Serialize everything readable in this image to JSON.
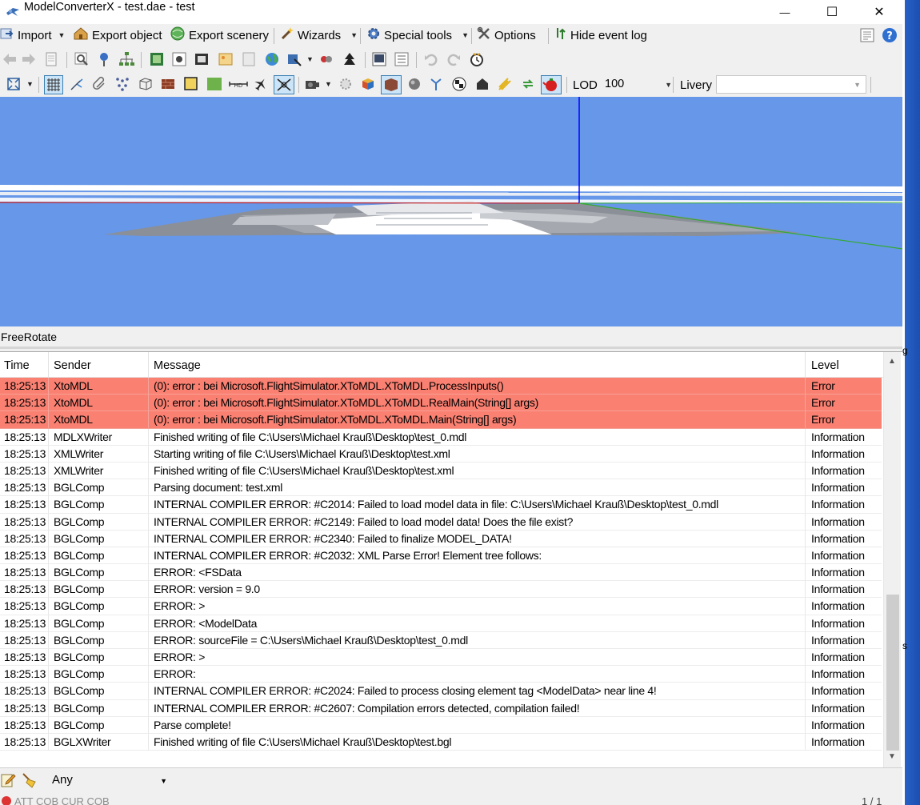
{
  "window": {
    "title": "ModelConverterX - test.dae - test",
    "minimize_glyph": "—",
    "maximize_glyph": "☐",
    "close_glyph": "✕"
  },
  "toolbar1": {
    "import": "Import",
    "export_object": "Export object",
    "export_scenery": "Export scenery",
    "wizards": "Wizards",
    "special_tools": "Special tools",
    "options": "Options",
    "hide_event_log": "Hide event log"
  },
  "toolbar3": {
    "lod_label": "LOD",
    "lod_value": "100",
    "livery_label": "Livery",
    "livery_value": ""
  },
  "viewport": {
    "mode": "FreeRotate"
  },
  "log": {
    "columns": [
      "Time",
      "Sender",
      "Message",
      "Level"
    ],
    "rows": [
      {
        "time": "18:25:13",
        "sender": "XtoMDL",
        "message": "(0): error :    bei Microsoft.FlightSimulator.XToMDL.XToMDL.ProcessInputs()",
        "level": "Error"
      },
      {
        "time": "18:25:13",
        "sender": "XtoMDL",
        "message": "(0): error :    bei Microsoft.FlightSimulator.XToMDL.XToMDL.RealMain(String[] args)",
        "level": "Error"
      },
      {
        "time": "18:25:13",
        "sender": "XtoMDL",
        "message": "(0): error :    bei Microsoft.FlightSimulator.XToMDL.XToMDL.Main(String[] args)",
        "level": "Error"
      },
      {
        "time": "18:25:13",
        "sender": "MDLXWriter",
        "message": "Finished writing of file C:\\Users\\Michael Krauß\\Desktop\\test_0.mdl",
        "level": "Information"
      },
      {
        "time": "18:25:13",
        "sender": "XMLWriter",
        "message": "Starting writing of file C:\\Users\\Michael Krauß\\Desktop\\test.xml",
        "level": "Information"
      },
      {
        "time": "18:25:13",
        "sender": "XMLWriter",
        "message": "Finished writing of file C:\\Users\\Michael Krauß\\Desktop\\test.xml",
        "level": "Information"
      },
      {
        "time": "18:25:13",
        "sender": "BGLComp",
        "message": "Parsing document: test.xml",
        "level": "Information"
      },
      {
        "time": "18:25:13",
        "sender": "BGLComp",
        "message": "INTERNAL COMPILER ERROR:  #C2014: Failed to load model data in file: C:\\Users\\Michael Krauß\\Desktop\\test_0.mdl",
        "level": "Information"
      },
      {
        "time": "18:25:13",
        "sender": "BGLComp",
        "message": "INTERNAL COMPILER ERROR:  #C2149: Failed to load model data!  Does the file exist?",
        "level": "Information"
      },
      {
        "time": "18:25:13",
        "sender": "BGLComp",
        "message": "INTERNAL COMPILER ERROR:  #C2340: Failed to finalize MODEL_DATA!",
        "level": "Information"
      },
      {
        "time": "18:25:13",
        "sender": "BGLComp",
        "message": "INTERNAL COMPILER ERROR:  #C2032: XML Parse Error!  Element tree follows:",
        "level": "Information"
      },
      {
        "time": "18:25:13",
        "sender": "BGLComp",
        "message": "ERROR: <FSData",
        "level": "Information"
      },
      {
        "time": "18:25:13",
        "sender": "BGLComp",
        "message": "ERROR: version = 9.0",
        "level": "Information"
      },
      {
        "time": "18:25:13",
        "sender": "BGLComp",
        "message": "ERROR: >",
        "level": "Information"
      },
      {
        "time": "18:25:13",
        "sender": "BGLComp",
        "message": "ERROR: <ModelData",
        "level": "Information"
      },
      {
        "time": "18:25:13",
        "sender": "BGLComp",
        "message": "ERROR: sourceFile = C:\\Users\\Michael Krauß\\Desktop\\test_0.mdl",
        "level": "Information"
      },
      {
        "time": "18:25:13",
        "sender": "BGLComp",
        "message": "ERROR: >",
        "level": "Information"
      },
      {
        "time": "18:25:13",
        "sender": "BGLComp",
        "message": "ERROR:",
        "level": "Information"
      },
      {
        "time": "18:25:13",
        "sender": "BGLComp",
        "message": "INTERNAL COMPILER ERROR:  #C2024: Failed to process closing element tag <ModelData> near line 4!",
        "level": "Information"
      },
      {
        "time": "18:25:13",
        "sender": "BGLComp",
        "message": "INTERNAL COMPILER ERROR:  #C2607: Compilation errors detected, compilation failed!",
        "level": "Information"
      },
      {
        "time": "18:25:13",
        "sender": "BGLComp",
        "message": "Parse complete!",
        "level": "Information"
      },
      {
        "time": "18:25:13",
        "sender": "BGLXWriter",
        "message": "Finished writing of file C:\\Users\\Michael Krauß\\Desktop\\test.bgl",
        "level": "Information"
      }
    ]
  },
  "filter": {
    "level_value": "Any"
  },
  "status": {
    "text": "ATT COB  CUR COB",
    "pager": "1 / 1"
  },
  "desktop_glyphs": {
    "side_top": "g",
    "side_bottom": "s"
  },
  "colors": {
    "error_row": "#fa8072",
    "viewport_sky": "#6697e8",
    "axis_z": "#0000ff",
    "axis_x": "#cc2222",
    "axis_y": "#33aa33"
  },
  "icons": [
    "app-logo-icon",
    "import-icon",
    "export-object-icon",
    "export-scenery-icon",
    "wizard-wand-icon",
    "gear-icon",
    "tools-icon",
    "event-log-icon",
    "document-icon",
    "help-icon",
    "back-arrow-icon",
    "forward-arrow-icon",
    "zoom-icon",
    "pin-icon",
    "hierarchy-icon",
    "grid-icon",
    "undo-icon",
    "redo-icon",
    "clock-icon",
    "fit-view-icon",
    "teapot-icon",
    "notepad-icon",
    "broom-icon"
  ]
}
